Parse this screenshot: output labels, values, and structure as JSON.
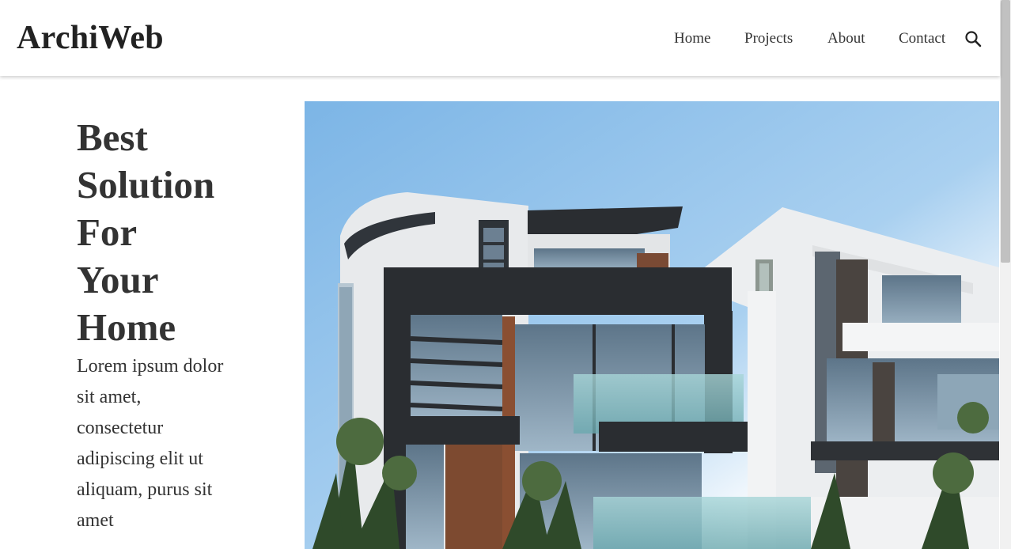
{
  "header": {
    "logo": "ArchiWeb",
    "nav": {
      "home": "Home",
      "projects": "Projects",
      "about": "About",
      "contact": "Contact"
    },
    "search_icon": "search-icon"
  },
  "hero": {
    "title_lines": [
      "Best",
      "Solution",
      "For",
      "Your",
      "Home"
    ],
    "description": "Lorem ipsum dolor sit amet, consectetur adipiscing elit ut aliquam, purus sit amet"
  },
  "colors": {
    "text": "#333333",
    "background": "#ffffff",
    "sky": "#8ec2ea"
  }
}
